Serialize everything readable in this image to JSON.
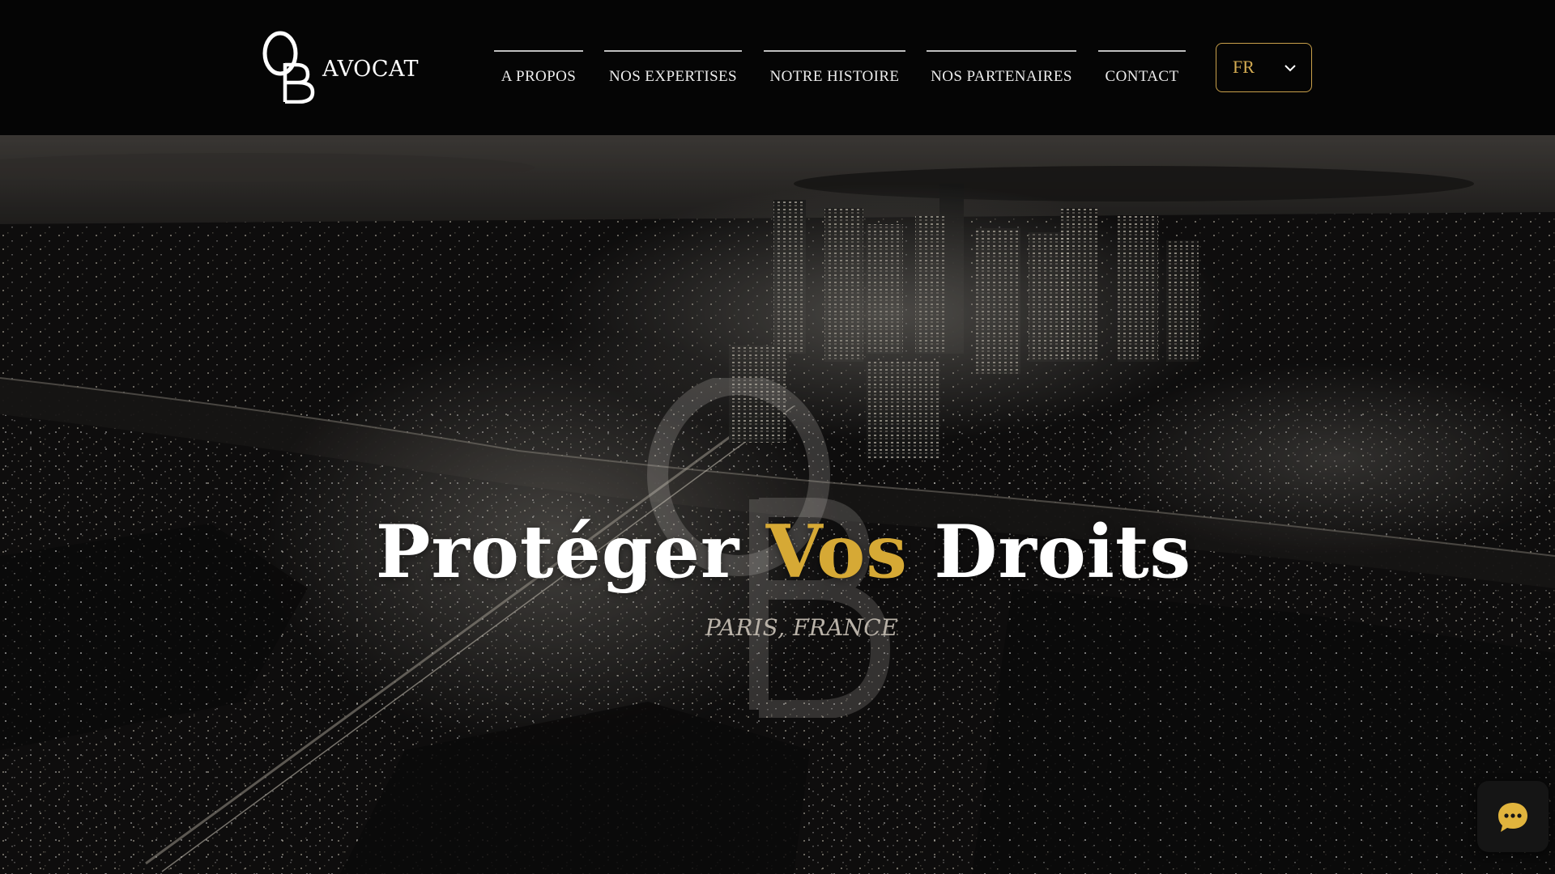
{
  "brand": {
    "word": "AVOCAT",
    "monogram": "OB"
  },
  "nav": {
    "items": [
      {
        "label": "A PROPOS"
      },
      {
        "label": "NOS EXPERTISES"
      },
      {
        "label": "NOTRE HISTOIRE"
      },
      {
        "label": "NOS PARTENAIRES"
      },
      {
        "label": "CONTACT"
      }
    ]
  },
  "language": {
    "selected": "FR",
    "icon": "chevron-down-icon"
  },
  "hero": {
    "headline_part1": "Protéger ",
    "headline_accent": "Vos",
    "headline_part2": " Droits",
    "subtitle": "PARIS, FRANCE",
    "background": "aerial-night-city-photo",
    "watermark": "ob-monogram"
  },
  "chat": {
    "icon": "chat-bubble-icon"
  },
  "colors": {
    "accent": "#d6a935",
    "header_bg": "#050505",
    "lang_border": "#c9a04a",
    "text": "#ffffff"
  }
}
